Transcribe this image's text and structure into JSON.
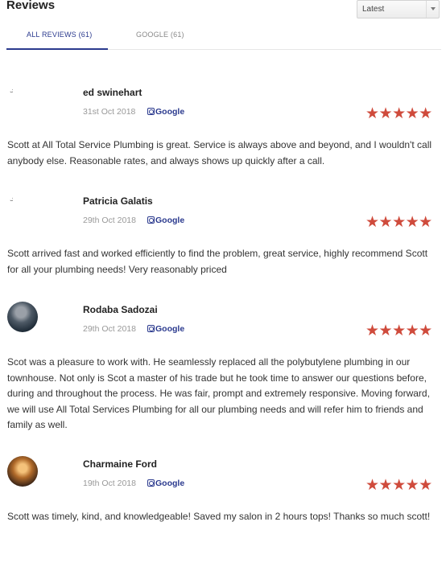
{
  "header": {
    "title": "Reviews",
    "sort_value": "Latest"
  },
  "tabs": [
    {
      "label": "ALL REVIEWS (61)"
    },
    {
      "label": "GOOGLE (61)"
    }
  ],
  "reviews": [
    {
      "name": "ed swinehart",
      "date": "31st Oct 2018",
      "source": "Google",
      "stars": "★★★★★",
      "rating": 5,
      "text": "Scott at All Total Service Plumbing is great. Service is always above and beyond, and I wouldn't call anybody else. Reasonable rates, and always shows up quickly after a call."
    },
    {
      "name": "Patricia Galatis",
      "date": "29th Oct 2018",
      "source": "Google",
      "stars": "★★★★★",
      "rating": 5,
      "text": "Scott arrived fast and worked efficiently to find the problem, great service, highly recommend Scott for all your plumbing needs! Very reasonably priced"
    },
    {
      "name": "Rodaba Sadozai",
      "date": "29th Oct 2018",
      "source": "Google",
      "stars": "★★★★★",
      "rating": 5,
      "text": "Scot was a pleasure to work with. He seamlessly replaced all the polybutylene plumbing in our townhouse. Not only is Scot a master of his trade but he took time to answer our questions before, during and throughout the process. He was fair, prompt and extremely responsive. Moving forward, we will use All Total Services Plumbing for all our plumbing needs and will refer him to friends and family as well."
    },
    {
      "name": "Charmaine Ford",
      "date": "19th Oct 2018",
      "source": "Google",
      "stars": "★★★★★",
      "rating": 5,
      "text": "Scott was timely, kind, and knowledgeable! Saved my salon in 2 hours tops! Thanks so much scott!"
    }
  ],
  "colors": {
    "accent": "#2b3a8e",
    "star": "#cf4b3c"
  }
}
